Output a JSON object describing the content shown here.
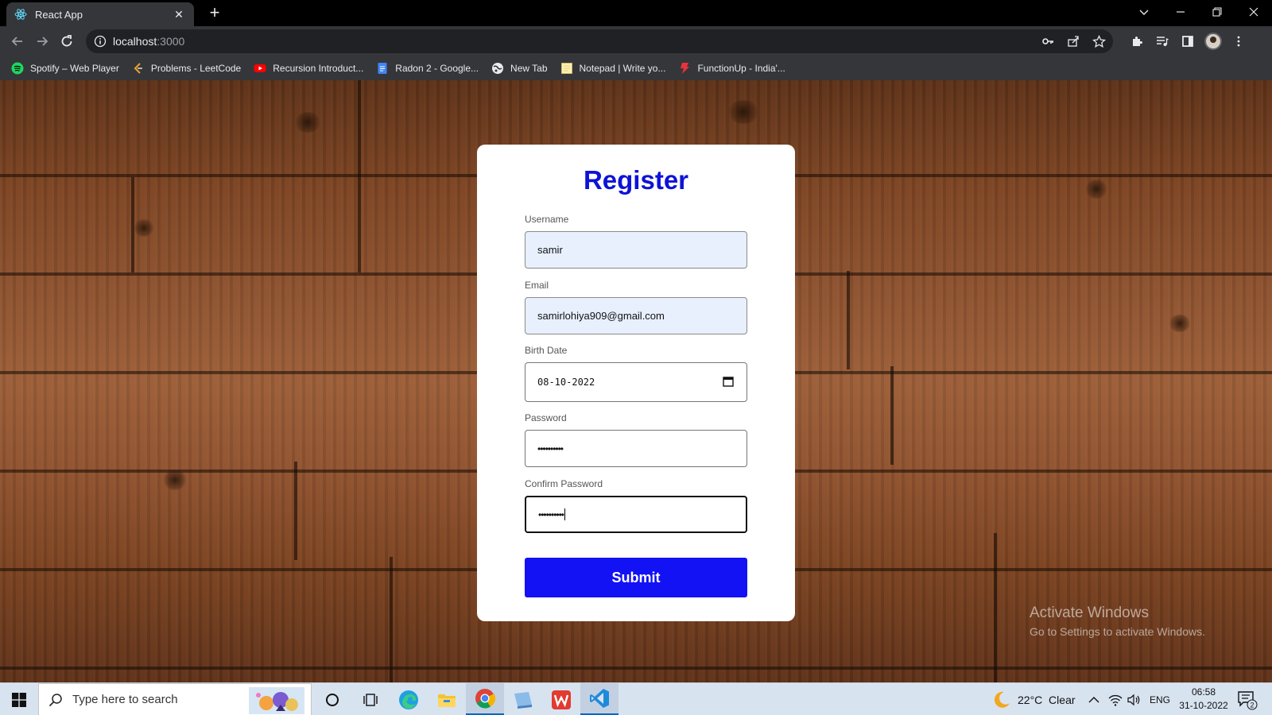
{
  "browser": {
    "tab_title": "React App",
    "url_host": "localhost",
    "url_port": ":3000",
    "bookmarks": [
      {
        "label": "Spotify – Web Player",
        "icon": "spotify-icon"
      },
      {
        "label": "Problems - LeetCode",
        "icon": "leetcode-icon"
      },
      {
        "label": "Recursion Introduct...",
        "icon": "youtube-icon"
      },
      {
        "label": "Radon 2 - Google...",
        "icon": "google-docs-icon"
      },
      {
        "label": "New Tab",
        "icon": "globe-icon"
      },
      {
        "label": "Notepad | Write yo...",
        "icon": "notepad-icon"
      },
      {
        "label": "FunctionUp - India'...",
        "icon": "functionup-icon"
      }
    ]
  },
  "form": {
    "title": "Register",
    "username_label": "Username",
    "username_value": "samir",
    "email_label": "Email",
    "email_value": "samirlohiya909@gmail.com",
    "birth_label": "Birth Date",
    "birth_value": "08-10-2022",
    "password_label": "Password",
    "password_value": "••••••••••",
    "confirm_label": "Confirm Password",
    "confirm_value": "••••••••••",
    "submit_label": "Submit",
    "title_color": "#0d13d6",
    "submit_color": "#1212f5"
  },
  "watermark": {
    "title": "Activate Windows",
    "subtitle": "Go to Settings to activate Windows."
  },
  "taskbar": {
    "search_placeholder": "Type here to search",
    "weather": "22°C  Clear",
    "language": "ENG",
    "time": "06:58",
    "date": "31-10-2022",
    "notification_count": "2"
  }
}
